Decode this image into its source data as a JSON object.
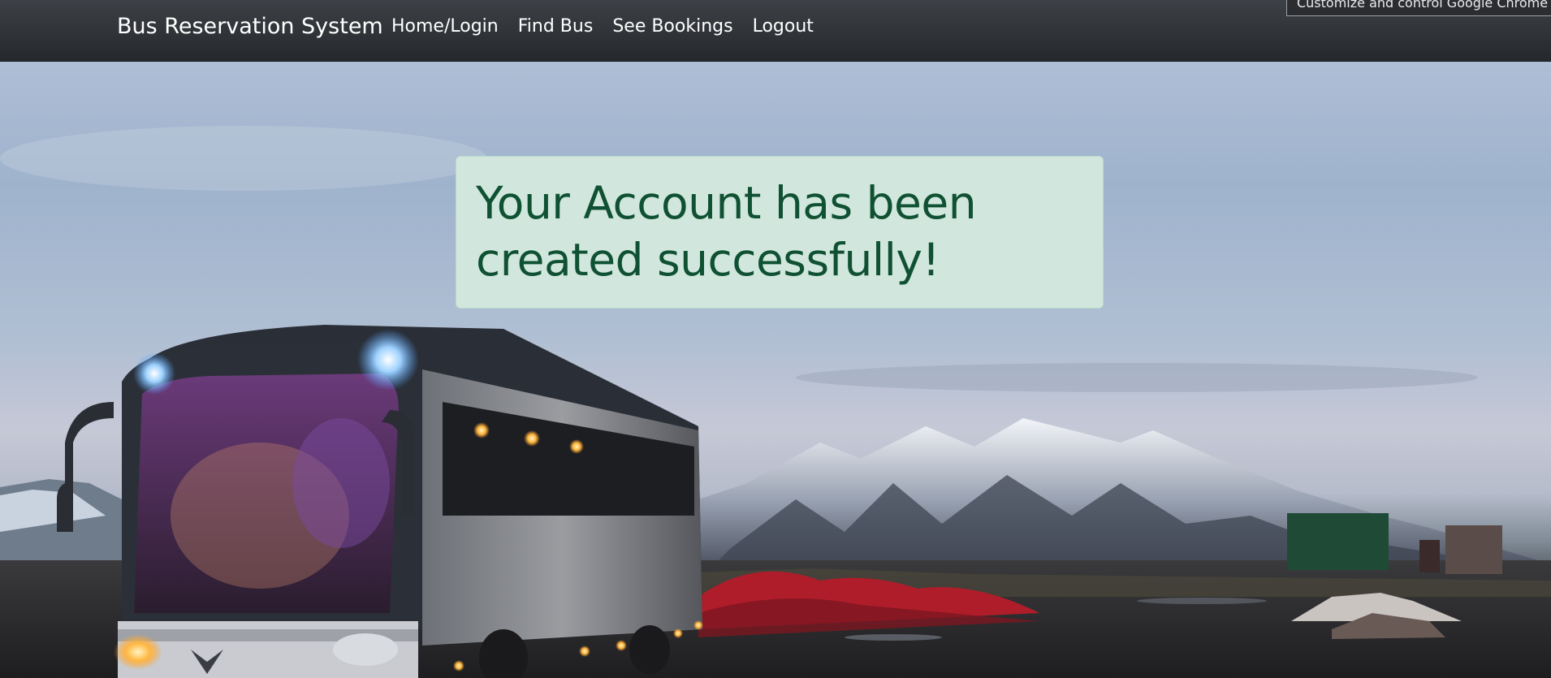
{
  "navbar": {
    "brand": "Bus Reservation System",
    "links": [
      {
        "label": "Home/Login"
      },
      {
        "label": "Find Bus"
      },
      {
        "label": "See Bookings"
      },
      {
        "label": "Logout"
      }
    ]
  },
  "tooltip": {
    "text": "Customize and control Google Chrome"
  },
  "alert": {
    "message": "Your Account has been created successfully!",
    "background_color": "#d1e7dd",
    "text_color": "#0f5132"
  },
  "hero": {
    "image_description_icon": "bus-landscape-image"
  }
}
